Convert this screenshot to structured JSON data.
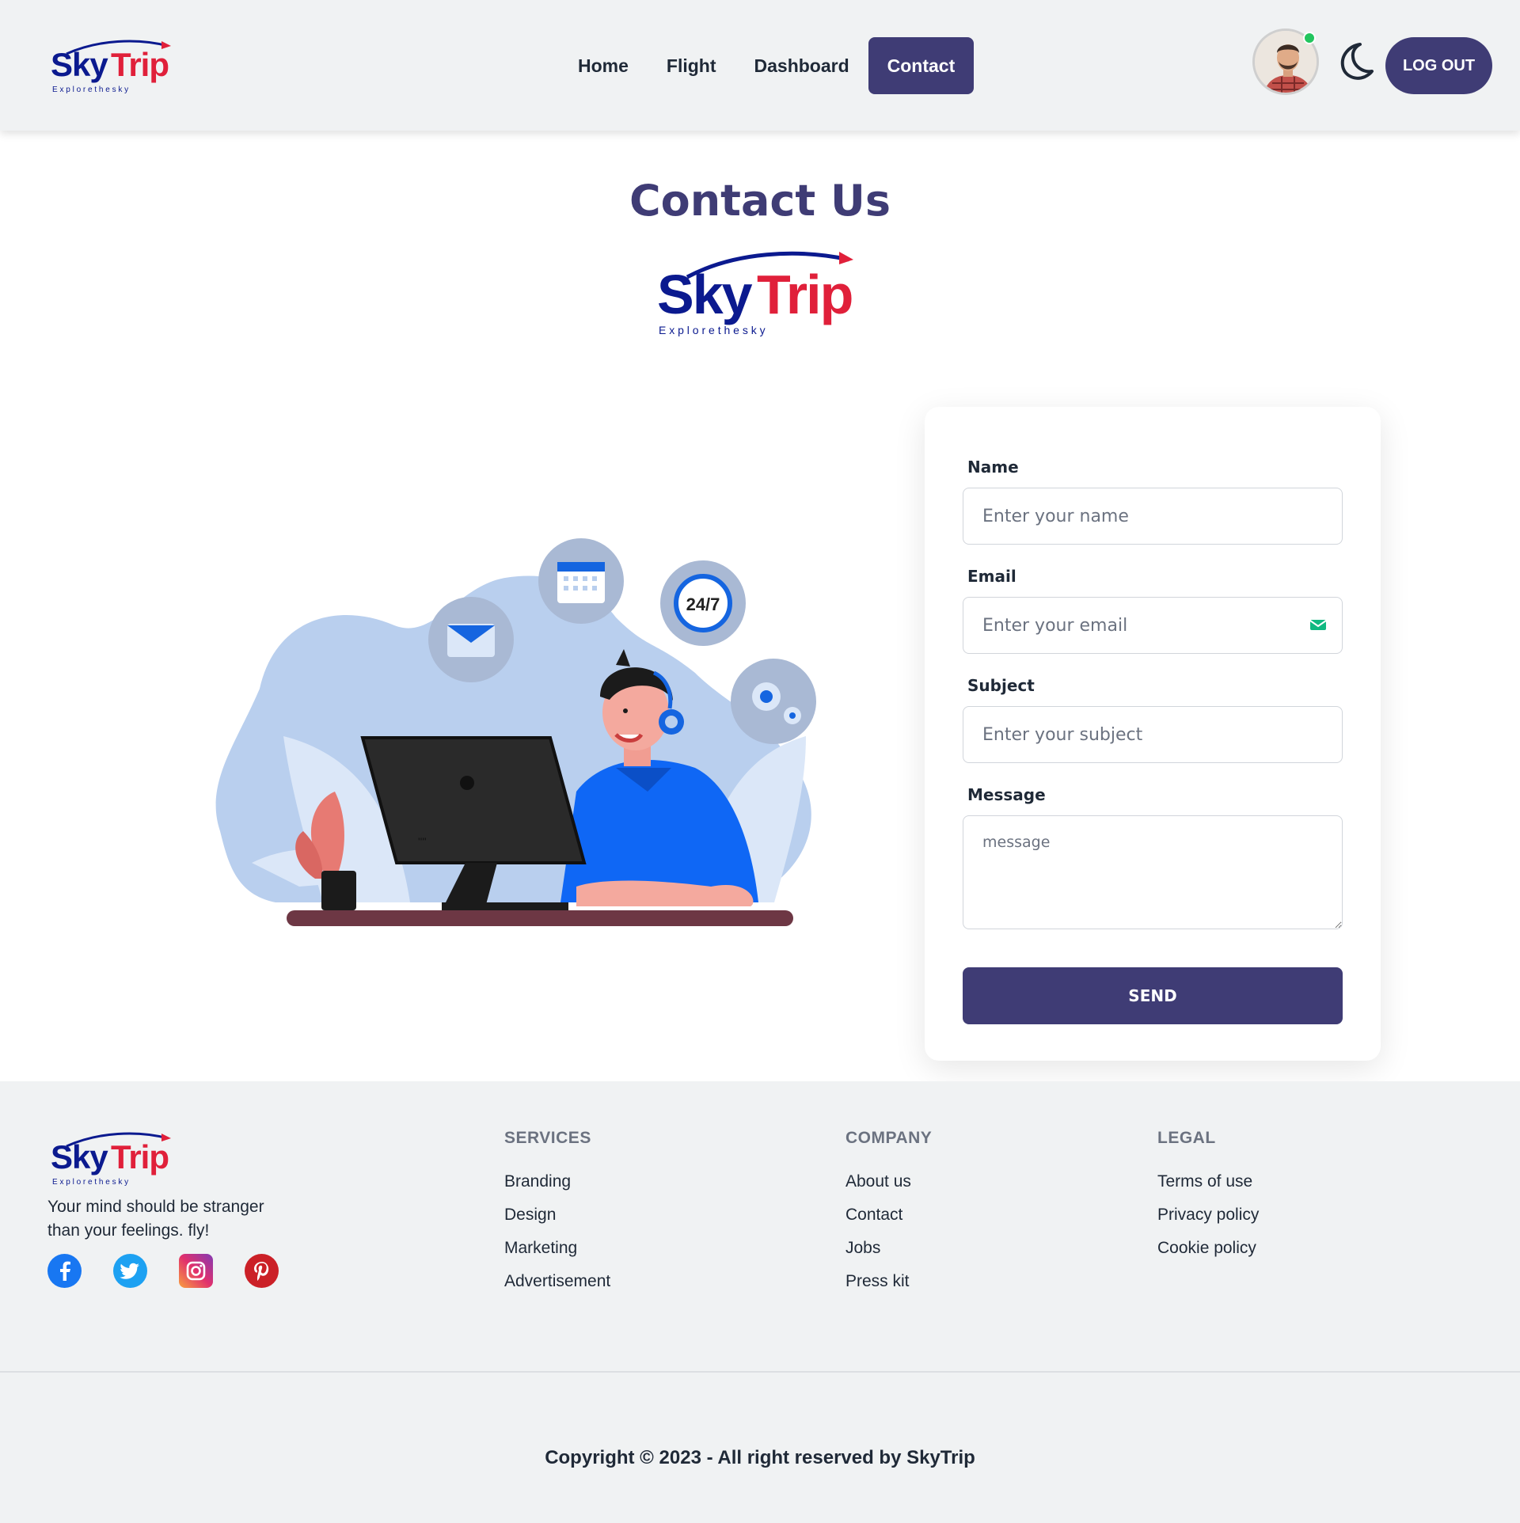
{
  "brand": {
    "logo_word_1": "Sky",
    "logo_word_2": "Trip",
    "logo_tagline": "E x p l o r e   t h e   s k y"
  },
  "nav": {
    "items": [
      {
        "label": "Home",
        "active": false
      },
      {
        "label": "Flight",
        "active": false
      },
      {
        "label": "Dashboard",
        "active": false
      },
      {
        "label": "Contact",
        "active": true
      }
    ],
    "logout_label": "LOG OUT"
  },
  "icons": {
    "avatar": "user-avatar",
    "theme_toggle": "moon-icon",
    "email_field": "mail-icon"
  },
  "page": {
    "title": "Contact Us"
  },
  "illustration": {
    "badge_24_7": "24/7"
  },
  "form": {
    "name_label": "Name",
    "name_placeholder": "Enter your name",
    "email_label": "Email",
    "email_placeholder": "Enter your email",
    "subject_label": "Subject",
    "subject_placeholder": "Enter your subject",
    "message_label": "Message",
    "message_placeholder": "message",
    "send_label": "SEND"
  },
  "footer": {
    "tagline": "Your mind should be stranger than your feelings. fly!",
    "socials": [
      "facebook-icon",
      "twitter-icon",
      "instagram-icon",
      "pinterest-icon"
    ],
    "services": {
      "title": "SERVICES",
      "items": [
        "Branding",
        "Design",
        "Marketing",
        "Advertisement"
      ]
    },
    "company": {
      "title": "COMPANY",
      "items": [
        "About us",
        "Contact",
        "Jobs",
        "Press kit"
      ]
    },
    "legal": {
      "title": "LEGAL",
      "items": [
        "Terms of use",
        "Privacy policy",
        "Cookie policy"
      ]
    },
    "copyright": "Copyright © 2023 - All right reserved by SkyTrip"
  },
  "colors": {
    "primary": "#3f3c75",
    "brand_blue": "#0b1a8f",
    "brand_red": "#e0203a",
    "header_bg": "#f0f2f3",
    "online": "#22c55e"
  }
}
